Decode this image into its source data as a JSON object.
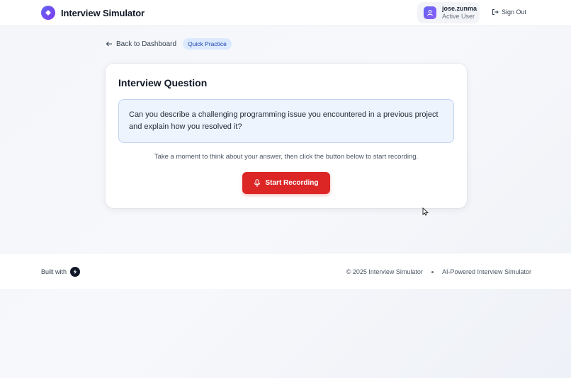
{
  "header": {
    "app_title": "Interview Simulator",
    "user": {
      "name": "jose.zunma",
      "status": "Active User"
    },
    "sign_out_label": "Sign Out"
  },
  "nav": {
    "back_label": "Back to Dashboard",
    "mode_badge": "Quick Practice"
  },
  "card": {
    "title": "Interview Question",
    "question": "Can you describe a challenging programming issue you encountered in a previous project and explain how you resolved it?",
    "hint": "Take a moment to think about your answer, then click the button below to start recording.",
    "record_button_label": "Start Recording"
  },
  "footer": {
    "built_with_label": "Built with",
    "copyright": "© 2025 Interview Simulator",
    "tagline": "AI-Powered Interview Simulator"
  },
  "colors": {
    "accent": "#6366f1",
    "record_button": "#dc2626",
    "question_bg": "#eef4fd",
    "badge_bg": "#dbeafe"
  },
  "icons": [
    "brand-logo-icon",
    "user-icon",
    "sign-out-icon",
    "arrow-left-icon",
    "microphone-icon",
    "bolt-icon",
    "mouse-cursor-icon"
  ]
}
